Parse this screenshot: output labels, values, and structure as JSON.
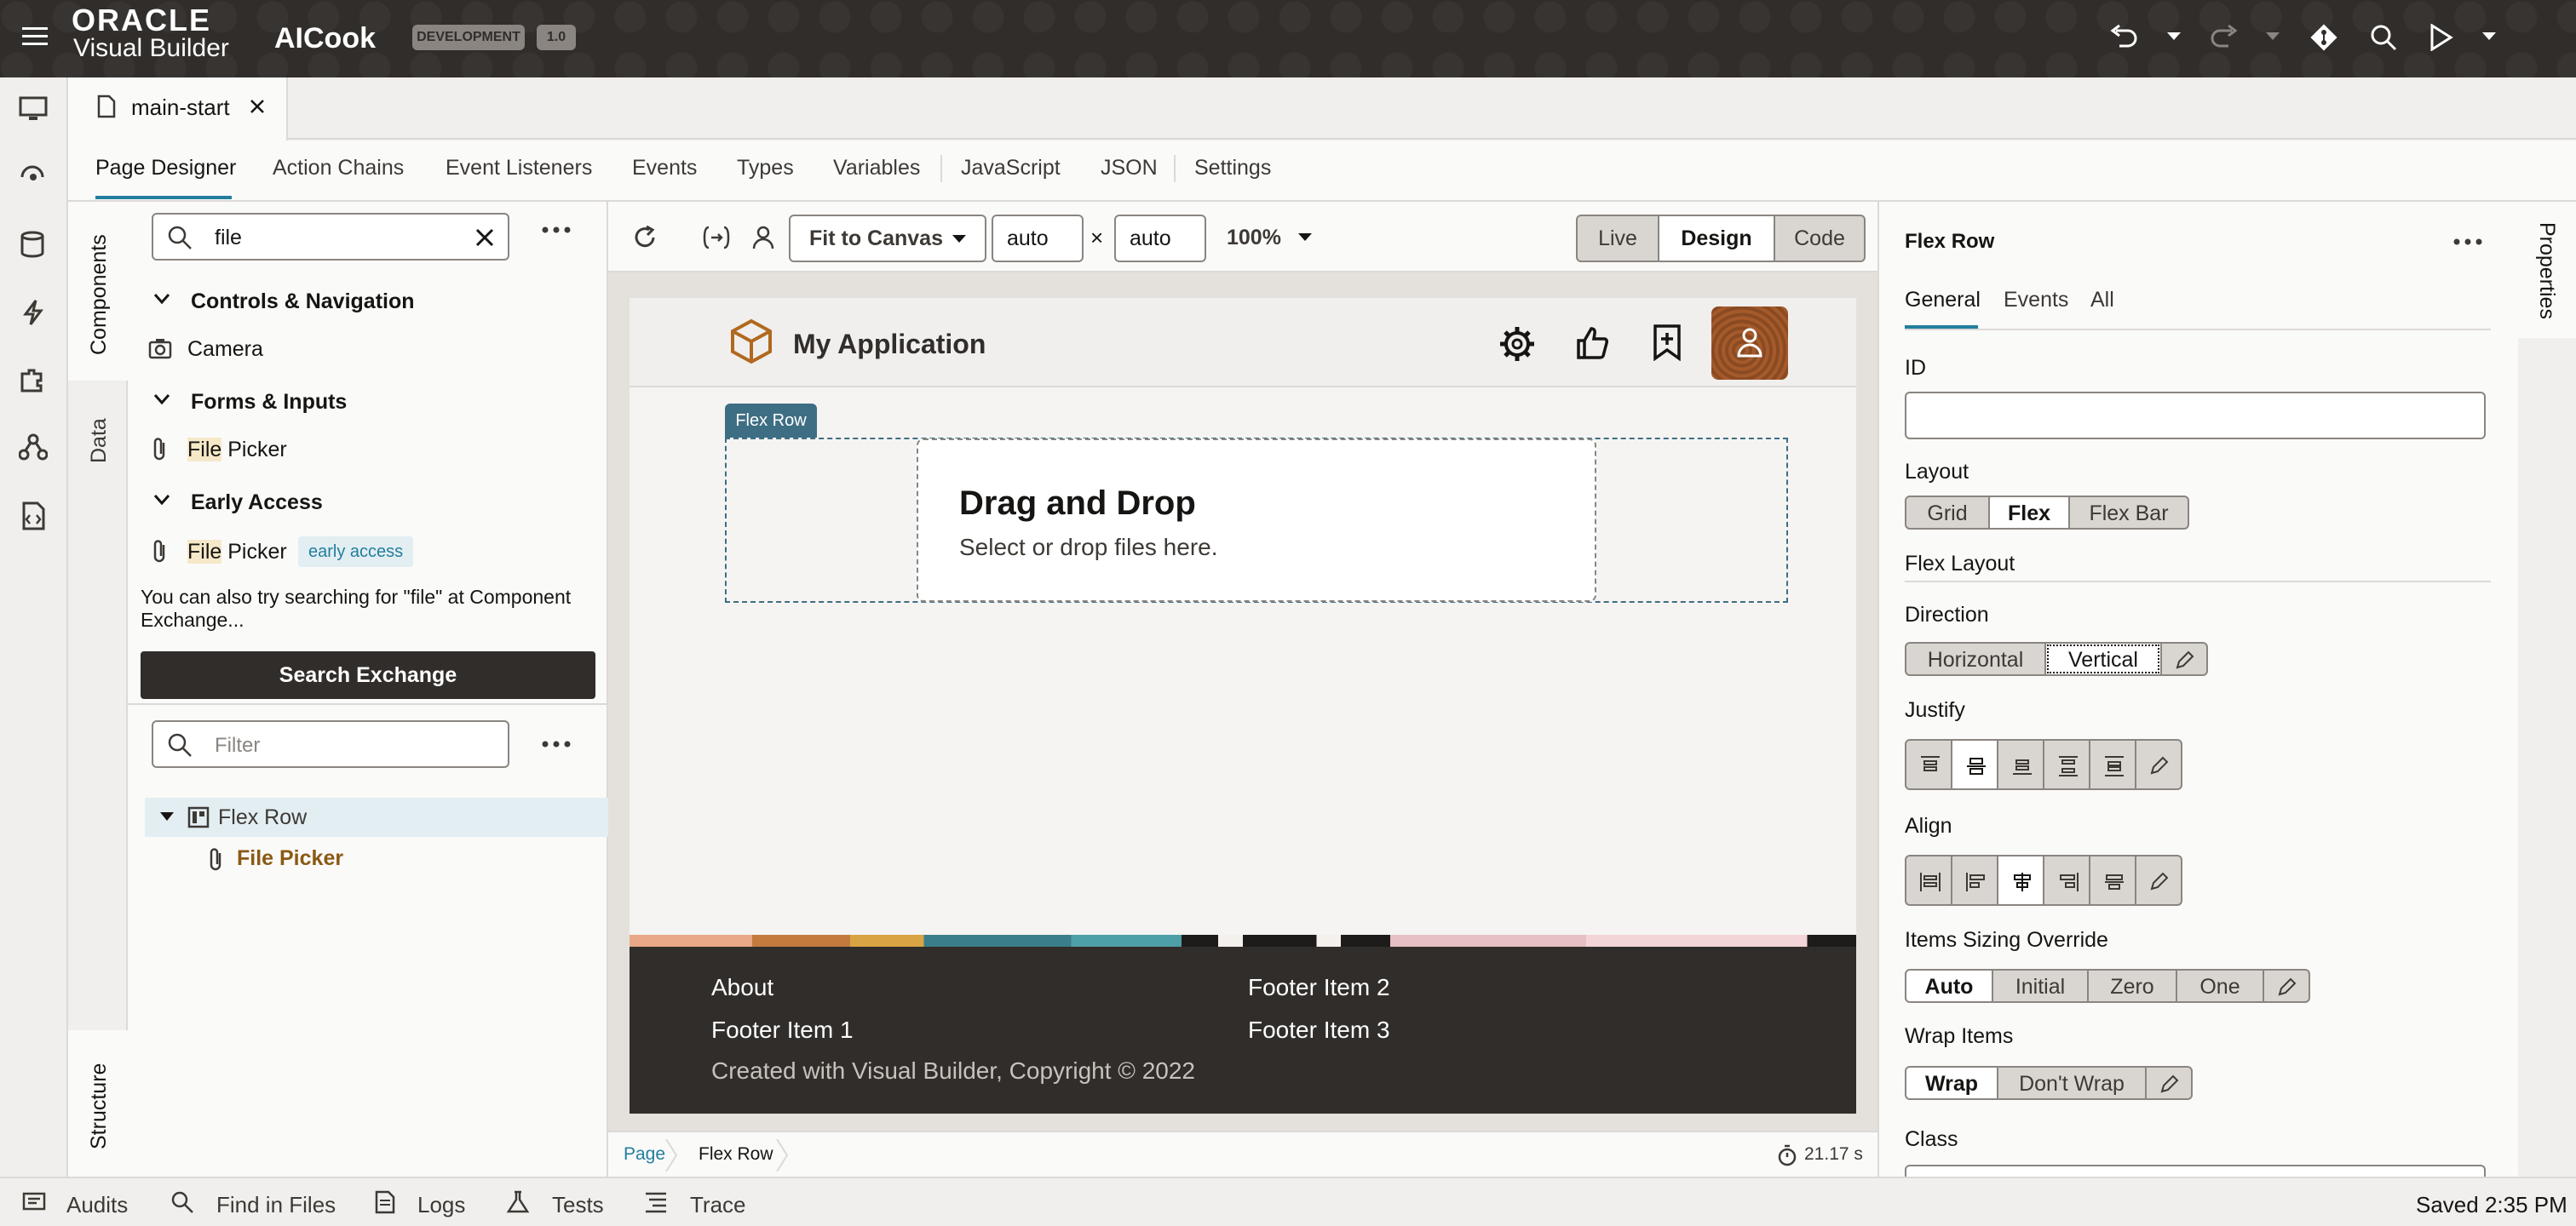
{
  "topbar": {
    "oracle": "ORACLE",
    "vb": "Visual Builder",
    "app_name": "AICook",
    "env_badge": "DEVELOPMENT",
    "version_badge": "1.0"
  },
  "file_tab": {
    "label": "main-start"
  },
  "subtabs": [
    "Page Designer",
    "Action Chains",
    "Event Listeners",
    "Events",
    "Types",
    "Variables",
    "JavaScript",
    "JSON",
    "Settings"
  ],
  "side_tabs": {
    "components": "Components",
    "data": "Data",
    "structure": "Structure",
    "properties": "Properties"
  },
  "components": {
    "search_value": "file",
    "groups": [
      {
        "title": "Controls & Navigation",
        "item": "Camera"
      },
      {
        "title": "Forms & Inputs",
        "item_hl": "File",
        "item_rest": " Picker"
      },
      {
        "title": "Early Access",
        "item_hl": "File",
        "item_rest": " Picker",
        "tag": "early access"
      }
    ],
    "hint": "You can also try searching for \"file\" at Component Exchange...",
    "exchange_button": "Search Exchange",
    "filter_placeholder": "Filter"
  },
  "structure": {
    "nodes": [
      {
        "label": "Flex Row"
      },
      {
        "label": "File Picker"
      }
    ]
  },
  "canvas_toolbar": {
    "fit": "Fit to Canvas",
    "width": "auto",
    "times": "×",
    "height": "auto",
    "zoom": "100%",
    "modes": [
      "Live",
      "Design",
      "Code"
    ]
  },
  "app_preview": {
    "title": "My Application",
    "flex_tag": "Flex Row",
    "dnd_title": "Drag and Drop",
    "dnd_sub": "Select or drop files here.",
    "footer": {
      "links": [
        "About",
        "Footer Item 2",
        "Footer Item 1",
        "Footer Item 3"
      ],
      "copyright": "Created with Visual Builder, Copyright © 2022"
    }
  },
  "breadcrumb": {
    "page": "Page",
    "current": "Flex Row",
    "timer": "21.17 s"
  },
  "properties": {
    "title": "Flex Row",
    "tabs": [
      "General",
      "Events",
      "All"
    ],
    "id_label": "ID",
    "layout_label": "Layout",
    "layout_opts": [
      "Grid",
      "Flex",
      "Flex Bar"
    ],
    "flex_layout": "Flex Layout",
    "direction_label": "Direction",
    "direction_opts": [
      "Horizontal",
      "Vertical"
    ],
    "justify_label": "Justify",
    "align_label": "Align",
    "sizing_label": "Items Sizing Override",
    "sizing_opts": [
      "Auto",
      "Initial",
      "Zero",
      "One"
    ],
    "wrap_label": "Wrap Items",
    "wrap_opts": [
      "Wrap",
      "Don't Wrap"
    ],
    "class_label": "Class"
  },
  "bottombar": {
    "items": [
      "Audits",
      "Find in Files",
      "Logs",
      "Tests",
      "Trace"
    ],
    "saved": "Saved 2:35 PM"
  },
  "colors": {
    "topbar": "#312d2a",
    "accent": "#227e9e",
    "highlight": "#8a5a13",
    "footer": "#312d2a"
  }
}
